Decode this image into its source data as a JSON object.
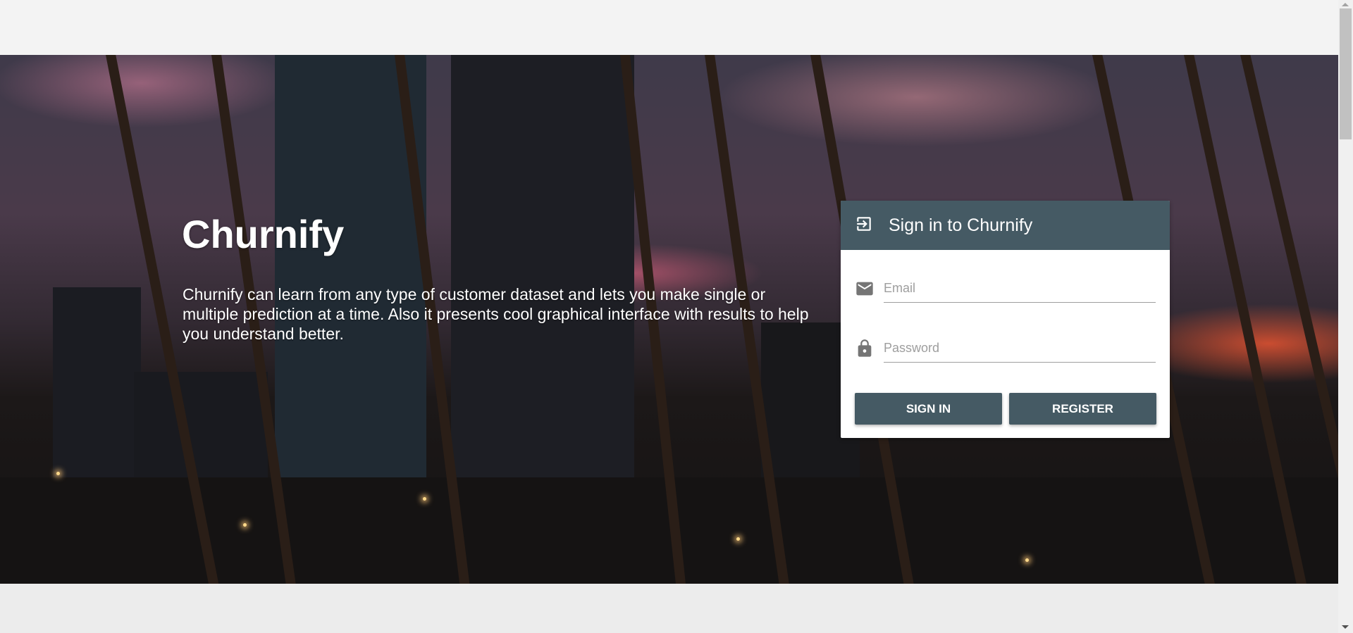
{
  "hero": {
    "title": "Churnify",
    "description": "Churnify can learn from any type of customer dataset and lets you make single or multiple prediction at a time. Also it presents cool graphical interface with results to help you understand better."
  },
  "login_card": {
    "icon": "login-icon",
    "title": "Sign in to Churnify",
    "email": {
      "icon": "mail-icon",
      "placeholder": "Email",
      "value": ""
    },
    "password": {
      "icon": "lock-icon",
      "placeholder": "Password",
      "value": ""
    },
    "sign_in_label": "SIGN IN",
    "register_label": "REGISTER"
  },
  "colors": {
    "primary": "#455a64"
  }
}
